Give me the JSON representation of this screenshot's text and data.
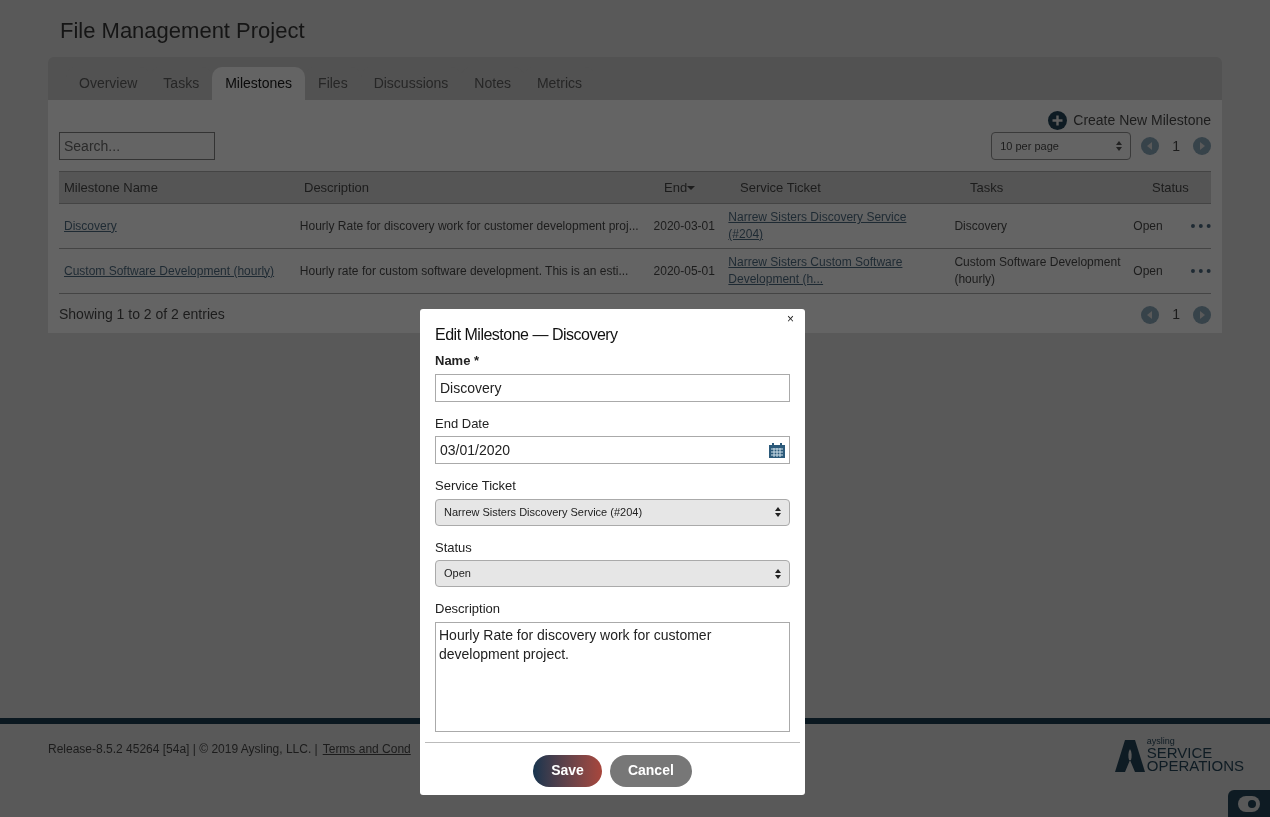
{
  "page_title": "File Management Project",
  "tabs": [
    {
      "label": "Overview",
      "selected": false
    },
    {
      "label": "Tasks",
      "selected": false
    },
    {
      "label": "Milestones",
      "selected": true
    },
    {
      "label": "Files",
      "selected": false
    },
    {
      "label": "Discussions",
      "selected": false
    },
    {
      "label": "Notes",
      "selected": false
    },
    {
      "label": "Metrics",
      "selected": false
    }
  ],
  "create_button": "Create New Milestone",
  "search": {
    "placeholder": "Search..."
  },
  "page_size": "10 per page",
  "page_number": "1",
  "table": {
    "columns": [
      {
        "label": "Milestone Name",
        "sorted": false
      },
      {
        "label": "Description",
        "sorted": false
      },
      {
        "label": "End",
        "sorted": true
      },
      {
        "label": "Service Ticket",
        "sorted": false
      },
      {
        "label": "Tasks",
        "sorted": false
      },
      {
        "label": "Status",
        "sorted": false
      }
    ],
    "rows": [
      {
        "name": "Discovery",
        "description": "Hourly Rate for discovery work for customer development proj...",
        "end": "2020-03-01",
        "ticket": "Narrew Sisters Discovery Service (#204)",
        "tasks": "Discovery",
        "status": "Open"
      },
      {
        "name": "Custom Software Development (hourly)",
        "description": "Hourly rate for custom software development. This is an esti...",
        "end": "2020-05-01",
        "ticket": "Narrew Sisters Custom Software Development (h...",
        "tasks": "Custom Software Development (hourly)",
        "status": "Open"
      }
    ]
  },
  "entries_info": "Showing 1 to 2 of 2 entries",
  "bottom_page_number": "1",
  "footer": {
    "text": "Release-8.5.2 45264 [54a] | © 2019 Aysling, LLC. |",
    "link": "Terms and Cond",
    "logo_small": "aysling",
    "logo_line1": "SERVICE",
    "logo_line2": "OPERATIONS"
  },
  "modal": {
    "title": "Edit Milestone — Discovery",
    "close": "×",
    "fields": [
      {
        "kind": "text",
        "label": "Name *",
        "value": "Discovery"
      },
      {
        "kind": "date",
        "label": "End Date",
        "value": "03/01/2020"
      },
      {
        "kind": "select",
        "label": "Service Ticket",
        "value": "Narrew Sisters Discovery Service (#204)"
      },
      {
        "kind": "select",
        "label": "Status",
        "value": "Open"
      },
      {
        "kind": "textarea",
        "label": "Description",
        "value": "Hourly Rate for discovery work for customer development project."
      }
    ],
    "save": "Save",
    "cancel": "Cancel"
  }
}
